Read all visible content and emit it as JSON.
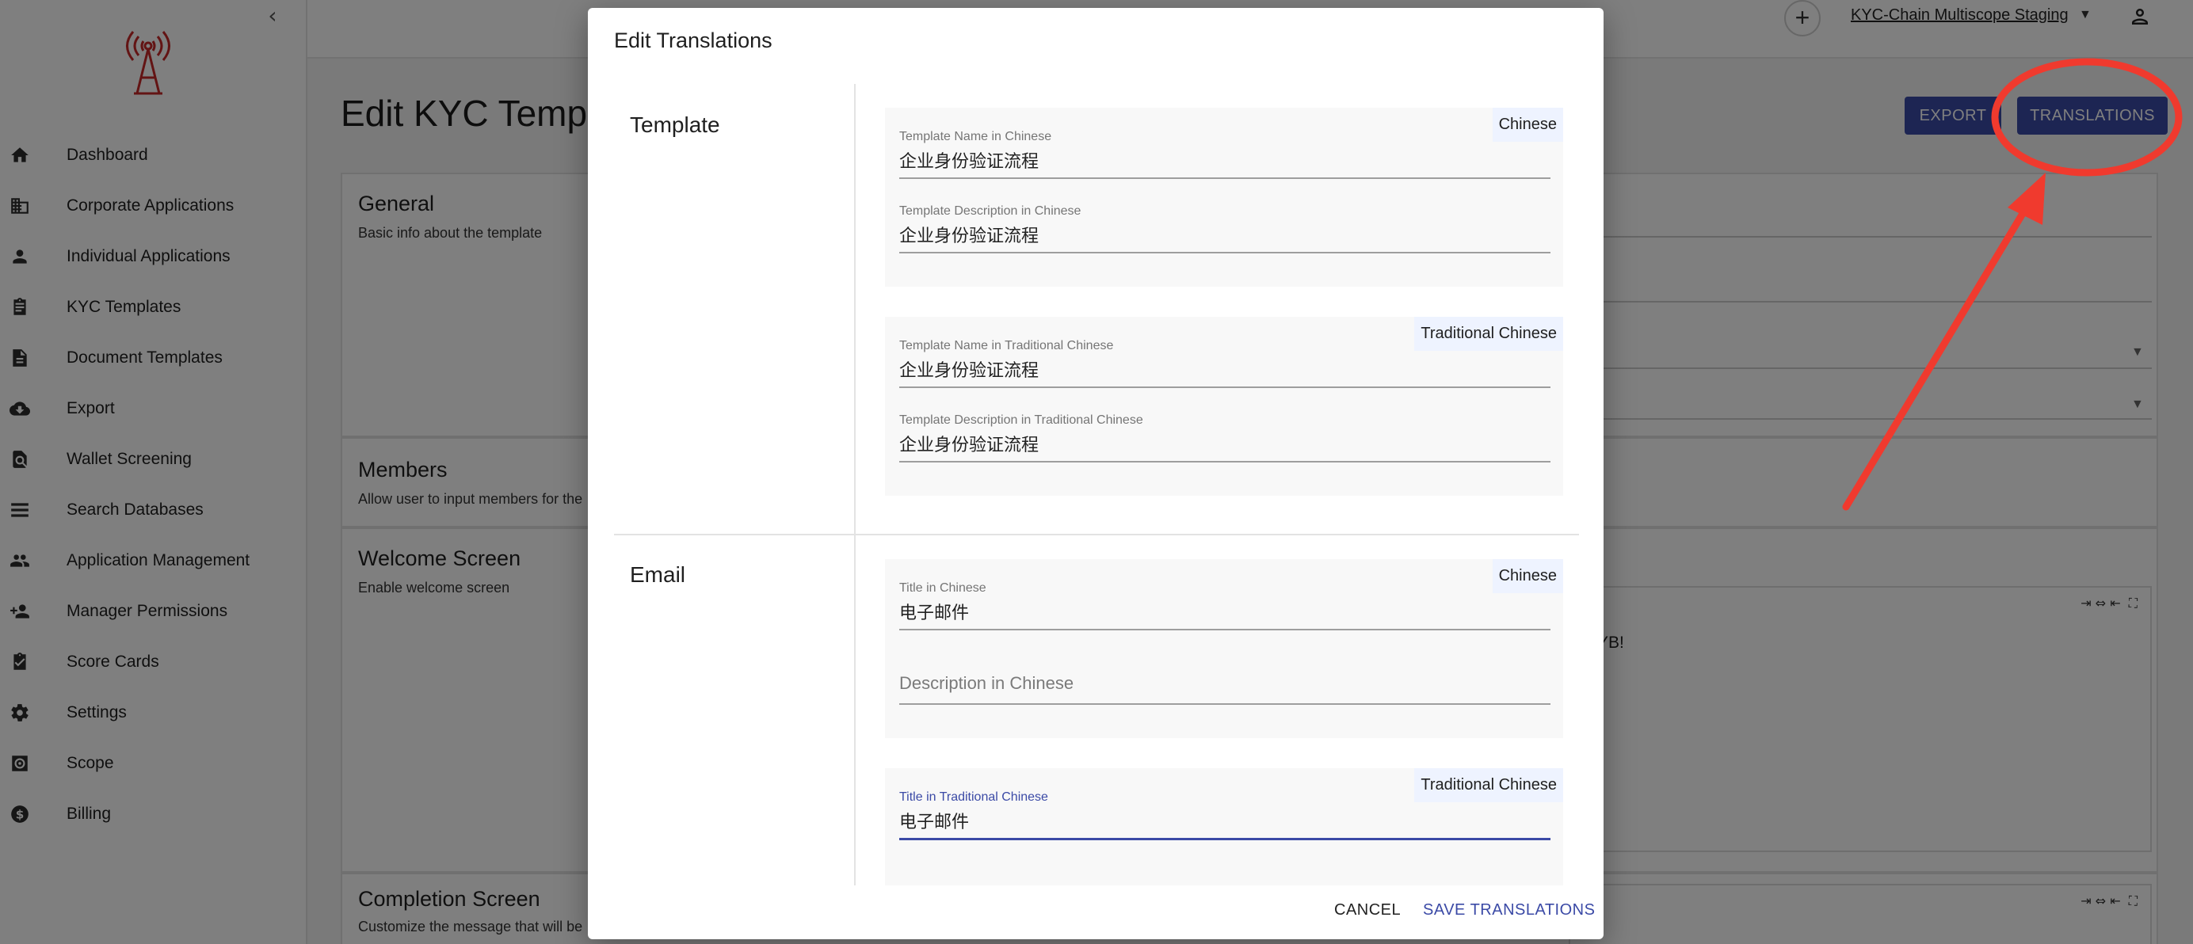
{
  "sidebar": {
    "items": [
      {
        "label": "Dashboard",
        "icon": "home-icon"
      },
      {
        "label": "Corporate Applications",
        "icon": "building-icon"
      },
      {
        "label": "Individual Applications",
        "icon": "person-icon"
      },
      {
        "label": "KYC Templates",
        "icon": "clipboard-icon"
      },
      {
        "label": "Document Templates",
        "icon": "document-icon"
      },
      {
        "label": "Export",
        "icon": "cloud-download-icon"
      },
      {
        "label": "Wallet Screening",
        "icon": "search-document-icon"
      },
      {
        "label": "Search Databases",
        "icon": "list-icon"
      },
      {
        "label": "Application Management",
        "icon": "people-icon"
      },
      {
        "label": "Manager Permissions",
        "icon": "person-add-icon"
      },
      {
        "label": "Score Cards",
        "icon": "assignment-check-icon"
      },
      {
        "label": "Settings",
        "icon": "gear-icon"
      },
      {
        "label": "Scope",
        "icon": "scope-icon"
      },
      {
        "label": "Billing",
        "icon": "dollar-icon"
      }
    ]
  },
  "appbar": {
    "workspace": "KYC-Chain Multiscope Staging"
  },
  "page": {
    "title": "Edit KYC Temp",
    "export_label": "EXPORT",
    "translations_label": "TRANSLATIONS",
    "cards": {
      "general_title": "General",
      "general_sub": "Basic info about the template",
      "members_title": "Members",
      "members_sub": "Allow user to input members for the",
      "welcome_title": "Welcome Screen",
      "welcome_sub": "Enable welcome screen",
      "welcome_text": "KYB!",
      "completion_title": "Completion Screen",
      "completion_sub": "Customize the message that will be"
    }
  },
  "dialog": {
    "title": "Edit Translations",
    "sections": {
      "template": {
        "label": "Template",
        "chinese": {
          "tag": "Chinese",
          "name_label": "Template Name in Chinese",
          "name_value": "企业身份验证流程",
          "desc_label": "Template Description in Chinese",
          "desc_value": "企业身份验证流程"
        },
        "traditional": {
          "tag": "Traditional Chinese",
          "name_label": "Template Name in Traditional Chinese",
          "name_value": "企业身份验证流程",
          "desc_label": "Template Description in Traditional Chinese",
          "desc_value": "企业身份验证流程"
        }
      },
      "email": {
        "label": "Email",
        "chinese": {
          "tag": "Chinese",
          "title_label": "Title in Chinese",
          "title_value": "电子邮件",
          "desc_placeholder": "Description in Chinese"
        },
        "traditional": {
          "tag": "Traditional Chinese",
          "title_label": "Title in Traditional Chinese",
          "title_value": "电子邮件"
        }
      }
    },
    "cancel_label": "CANCEL",
    "save_label": "SAVE TRANSLATIONS"
  },
  "colors": {
    "accent": "#3b4aa6",
    "logo_red": "#c62828",
    "annotation_red": "#f03a2e"
  }
}
